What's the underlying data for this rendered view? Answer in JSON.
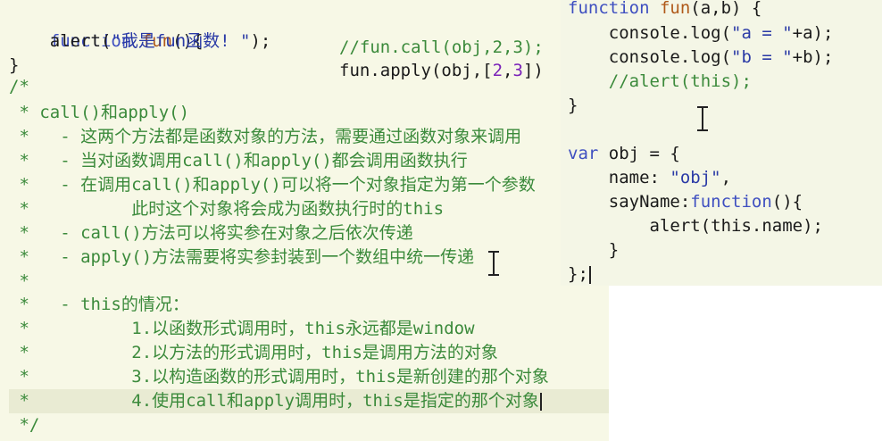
{
  "left": {
    "fn_line": {
      "kw": "function",
      "name": "fun",
      "rest": "(){"
    },
    "alert_line": {
      "call": "alert(",
      "str": "\"我是fun函数! \"",
      "end": ");"
    },
    "close": "}",
    "comment_open": "/*",
    "side_comment": "//fun.call(obj,2,3);",
    "side_apply_a": "fun.apply(obj,[",
    "side_apply_n1": "2",
    "side_apply_comma": ",",
    "side_apply_n2": "3",
    "side_apply_b": "])",
    "lines": [
      {
        "star": " * ",
        "text": "call()和apply()"
      },
      {
        "star": " *   - ",
        "text": "这两个方法都是函数对象的方法，需要通过函数对象来调用"
      },
      {
        "star": " *   - ",
        "text": "当对函数调用call()和apply()都会调用函数执行"
      },
      {
        "star": " *   - ",
        "text": "在调用call()和apply()可以将一个对象指定为第一个参数"
      },
      {
        "star": " *          ",
        "text": "此时这个对象将会成为函数执行时的this"
      },
      {
        "star": " *   - ",
        "text": "call()方法可以将实参在对象之后依次传递"
      },
      {
        "star": " *   - ",
        "text": "apply()方法需要将实参封装到一个数组中统一传递"
      },
      {
        "star": " *",
        "text": ""
      },
      {
        "star": " *   - ",
        "text": "this的情况："
      },
      {
        "star": " *          ",
        "text": "1.以函数形式调用时，this永远都是window"
      },
      {
        "star": " *          ",
        "text": "2.以方法的形式调用时，this是调用方法的对象"
      },
      {
        "star": " *          ",
        "text": "3.以构造函数的形式调用时，this是新创建的那个对象"
      },
      {
        "star": " *          ",
        "text": "4.使用call和apply调用时，this是指定的那个对象"
      }
    ],
    "comment_close": " */"
  },
  "right": {
    "fn_line": {
      "kw": "function",
      "name": "fun",
      "rest": "(a,b) {"
    },
    "l1": {
      "pre": "    console.log(",
      "str": "\"a = \"",
      "post": "+a);"
    },
    "l2": {
      "pre": "    console.log(",
      "str": "\"b = \"",
      "post": "+b);"
    },
    "l3": "    //alert(this);",
    "l4": "}",
    "l5": {
      "kw": "var",
      "rest": " obj = {"
    },
    "l6": {
      "pre": "    name: ",
      "str": "\"obj\"",
      "post": ","
    },
    "l7": {
      "pre": "    sayName:",
      "kw": "function",
      "post": "(){"
    },
    "l8": "        alert(this.name);",
    "l9": "    }",
    "l10": "};"
  },
  "colors": {
    "keyword": "#3e4fc0",
    "comment": "#3b8a3b",
    "string": "#2a3aa6",
    "number": "#7a22b8",
    "editor_bg": "#f7f8e6"
  }
}
